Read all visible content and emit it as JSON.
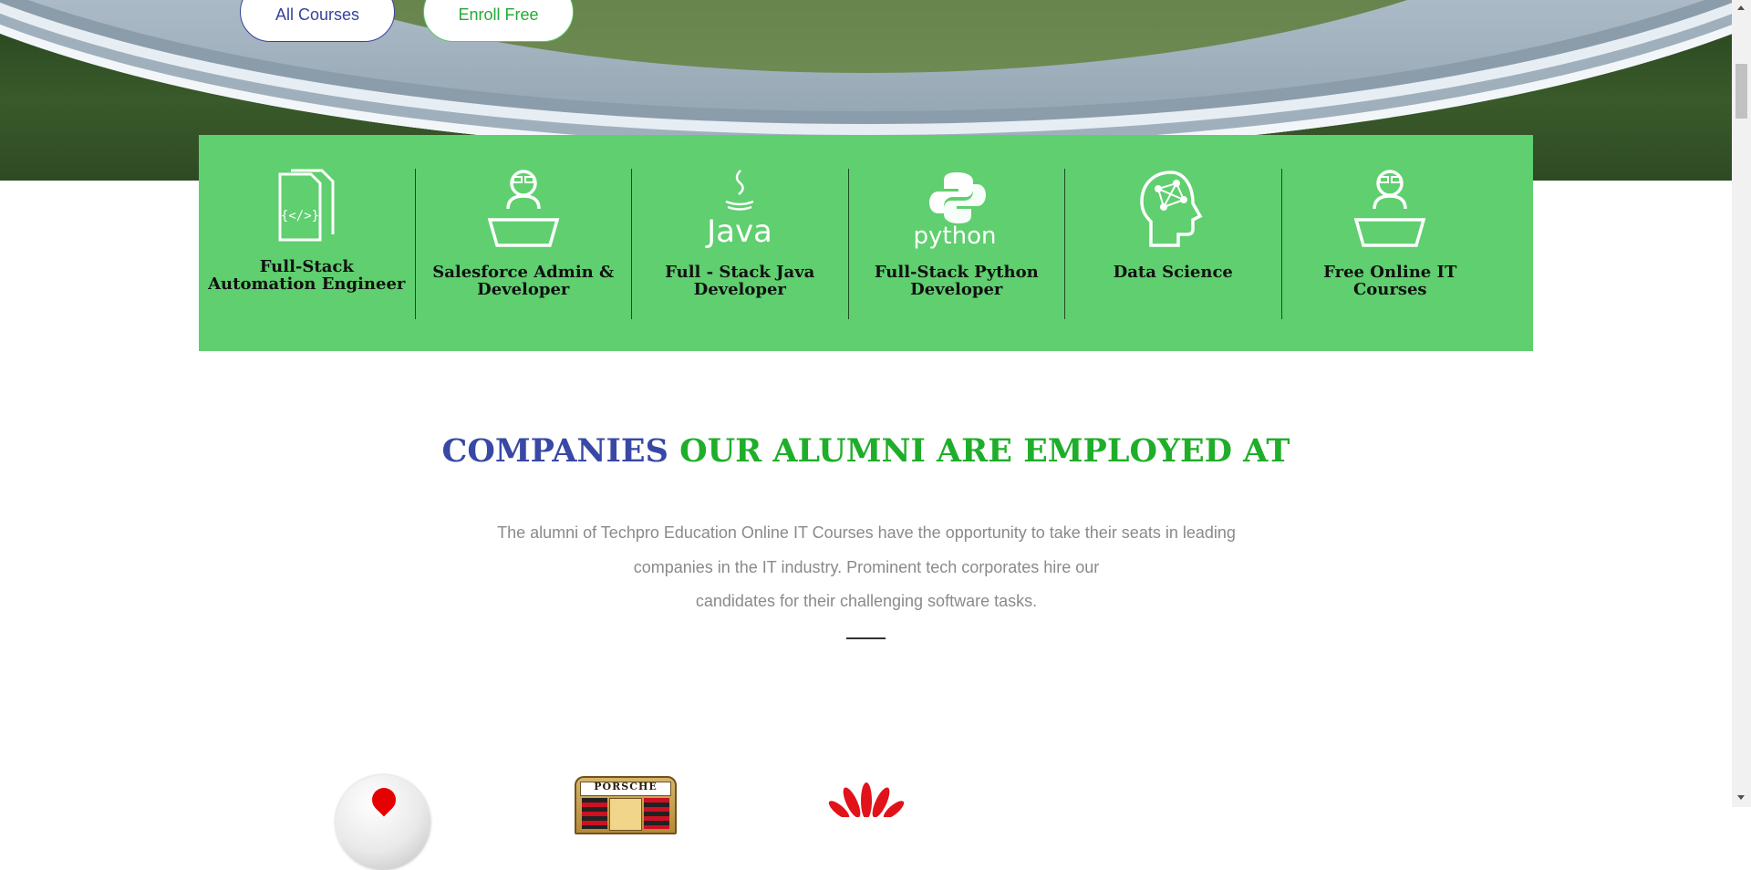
{
  "hero": {
    "buttons": [
      {
        "label": "All Courses"
      },
      {
        "label": "Enroll Free"
      }
    ]
  },
  "courses": [
    {
      "title": "Full-Stack Automation Engineer",
      "icon": "code-document-icon"
    },
    {
      "title": "Salesforce Admin & Developer",
      "icon": "person-laptop-icon"
    },
    {
      "title": "Full - Stack Java Developer",
      "icon": "java-logo-icon",
      "icon_text": "Java"
    },
    {
      "title": "Full-Stack Python Developer",
      "icon": "python-logo-icon",
      "icon_text": "python"
    },
    {
      "title": "Data Science",
      "icon": "brain-network-icon"
    },
    {
      "title": "Free Online IT Courses",
      "icon": "person-laptop-icon"
    }
  ],
  "companies": {
    "title_part1": "COMPANIES",
    "title_part2": "OUR ALUMNI ARE EMPLOYED AT",
    "description_lines": [
      "The alumni of Techpro Education Online IT Courses have the opportunity to take their seats in leading",
      "companies in the IT industry. Prominent tech corporates hire our",
      "candidates for their challenging software tasks."
    ],
    "logos": [
      {
        "name": "vodafone-logo"
      },
      {
        "name": "porsche-logo",
        "text": "PORSCHE"
      },
      {
        "name": "huawei-logo"
      }
    ]
  },
  "colors": {
    "band_green": "#5fcf6f",
    "title_blue": "#3848a5",
    "title_green": "#1fae2a",
    "text_gray": "#8a8a8a"
  }
}
